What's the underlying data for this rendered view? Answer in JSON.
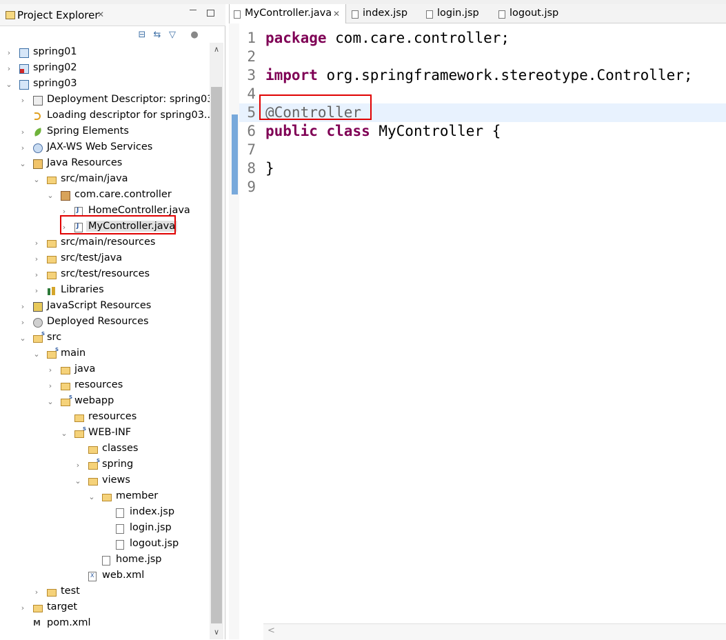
{
  "explorer": {
    "title": "Project Explorer",
    "close_glyph": "✕",
    "toolbar_icons": [
      "collapse-all-icon",
      "link-with-editor-icon",
      "filter-icon",
      "view-menu-icon"
    ]
  },
  "tree": [
    {
      "label": "spring01",
      "indent": 0,
      "twisty": ">",
      "icon": "project-icon"
    },
    {
      "label": "spring02",
      "indent": 0,
      "twisty": ">",
      "icon": "project-error-icon"
    },
    {
      "label": "spring03",
      "indent": 0,
      "twisty": "v",
      "icon": "project-icon"
    },
    {
      "label": "Deployment Descriptor: spring03",
      "indent": 1,
      "twisty": ">",
      "icon": "descriptor-icon"
    },
    {
      "label": "Loading descriptor for spring03...",
      "indent": 1,
      "twisty": "",
      "icon": "loading-icon"
    },
    {
      "label": "Spring Elements",
      "indent": 1,
      "twisty": ">",
      "icon": "spring-leaf-icon"
    },
    {
      "label": "JAX-WS Web Services",
      "indent": 1,
      "twisty": ">",
      "icon": "web-services-icon"
    },
    {
      "label": "Java Resources",
      "indent": 1,
      "twisty": "v",
      "icon": "java-resources-icon"
    },
    {
      "label": "src/main/java",
      "indent": 2,
      "twisty": "v",
      "icon": "source-folder-icon"
    },
    {
      "label": "com.care.controller",
      "indent": 3,
      "twisty": "v",
      "icon": "package-icon"
    },
    {
      "label": "HomeController.java",
      "indent": 4,
      "twisty": ">",
      "icon": "java-file-icon"
    },
    {
      "label": "MyController.java",
      "indent": 4,
      "twisty": ">",
      "icon": "java-file-icon",
      "selected": true
    },
    {
      "label": "src/main/resources",
      "indent": 2,
      "twisty": ">",
      "icon": "source-folder-icon"
    },
    {
      "label": "src/test/java",
      "indent": 2,
      "twisty": ">",
      "icon": "source-folder-icon"
    },
    {
      "label": "src/test/resources",
      "indent": 2,
      "twisty": ">",
      "icon": "source-folder-icon"
    },
    {
      "label": "Libraries",
      "indent": 2,
      "twisty": ">",
      "icon": "libraries-icon"
    },
    {
      "label": "JavaScript Resources",
      "indent": 1,
      "twisty": ">",
      "icon": "javascript-resources-icon"
    },
    {
      "label": "Deployed Resources",
      "indent": 1,
      "twisty": ">",
      "icon": "deployed-resources-icon"
    },
    {
      "label": "src",
      "indent": 1,
      "twisty": "v",
      "icon": "folder-spring-icon"
    },
    {
      "label": "main",
      "indent": 2,
      "twisty": "v",
      "icon": "folder-spring-icon"
    },
    {
      "label": "java",
      "indent": 3,
      "twisty": ">",
      "icon": "folder-icon"
    },
    {
      "label": "resources",
      "indent": 3,
      "twisty": ">",
      "icon": "folder-icon"
    },
    {
      "label": "webapp",
      "indent": 3,
      "twisty": "v",
      "icon": "folder-spring-icon"
    },
    {
      "label": "resources",
      "indent": 4,
      "twisty": "",
      "icon": "folder-icon"
    },
    {
      "label": "WEB-INF",
      "indent": 4,
      "twisty": "v",
      "icon": "folder-spring-icon"
    },
    {
      "label": "classes",
      "indent": 5,
      "twisty": "",
      "icon": "folder-icon"
    },
    {
      "label": "spring",
      "indent": 5,
      "twisty": ">",
      "icon": "folder-spring-icon"
    },
    {
      "label": "views",
      "indent": 5,
      "twisty": "v",
      "icon": "folder-icon"
    },
    {
      "label": "member",
      "indent": 6,
      "twisty": "v",
      "icon": "folder-icon"
    },
    {
      "label": "index.jsp",
      "indent": 7,
      "twisty": "",
      "icon": "jsp-file-icon"
    },
    {
      "label": "login.jsp",
      "indent": 7,
      "twisty": "",
      "icon": "jsp-file-icon"
    },
    {
      "label": "logout.jsp",
      "indent": 7,
      "twisty": "",
      "icon": "jsp-file-icon"
    },
    {
      "label": "home.jsp",
      "indent": 6,
      "twisty": "",
      "icon": "jsp-file-icon"
    },
    {
      "label": "web.xml",
      "indent": 5,
      "twisty": "",
      "icon": "xml-file-icon"
    },
    {
      "label": "test",
      "indent": 2,
      "twisty": ">",
      "icon": "folder-icon"
    },
    {
      "label": "target",
      "indent": 1,
      "twisty": ">",
      "icon": "folder-icon"
    },
    {
      "label": "pom.xml",
      "indent": 1,
      "twisty": "",
      "icon": "maven-pom-icon"
    }
  ],
  "editor": {
    "tabs": [
      {
        "label": "MyController.java",
        "active": true,
        "closable": true
      },
      {
        "label": "index.jsp"
      },
      {
        "label": "login.jsp"
      },
      {
        "label": "logout.jsp"
      }
    ],
    "close_glyph": "✕",
    "current_line": 5,
    "lines": [
      {
        "n": "1",
        "tokens": [
          {
            "t": "package",
            "k": "kw"
          },
          {
            "t": " com.care.controller;"
          }
        ]
      },
      {
        "n": "2",
        "tokens": []
      },
      {
        "n": "3",
        "tokens": [
          {
            "t": "import",
            "k": "kw"
          },
          {
            "t": " org.springframework.stereotype.Controller;"
          }
        ]
      },
      {
        "n": "4",
        "tokens": []
      },
      {
        "n": "5",
        "tokens": [
          {
            "t": "@Controller",
            "k": "ann"
          }
        ]
      },
      {
        "n": "6",
        "tokens": [
          {
            "t": "public",
            "k": "kw"
          },
          {
            "t": " "
          },
          {
            "t": "class",
            "k": "kw"
          },
          {
            "t": " MyController {"
          }
        ]
      },
      {
        "n": "7",
        "tokens": []
      },
      {
        "n": "8",
        "tokens": [
          {
            "t": "}"
          }
        ]
      },
      {
        "n": "9",
        "tokens": []
      }
    ]
  },
  "scroll": {
    "up_glyph": "∧",
    "down_glyph": "∨",
    "left_glyph": "<"
  },
  "highlight_color": "#e00000"
}
